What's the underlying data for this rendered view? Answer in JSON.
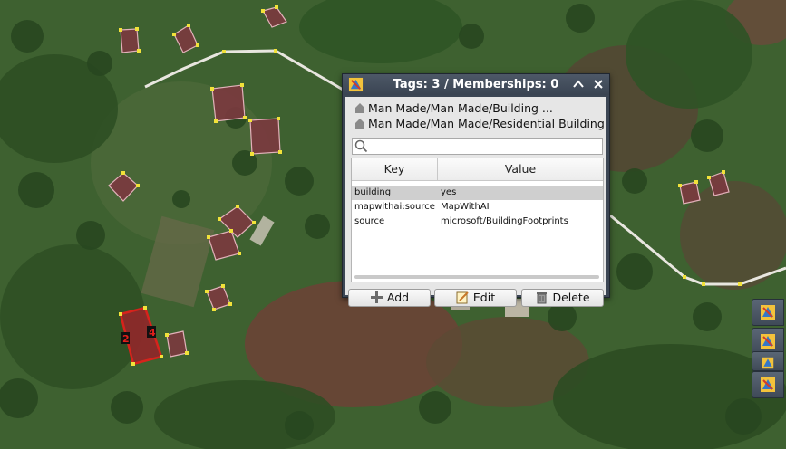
{
  "dialog": {
    "title": "Tags: 3 / Memberships: 0",
    "presets": [
      "Man Made/Man Made/Building ...",
      "Man Made/Man Made/Residential Building"
    ],
    "search_placeholder": "",
    "table": {
      "headers": {
        "key": "Key",
        "value": "Value"
      },
      "rows": [
        {
          "key": "building",
          "value": "yes"
        },
        {
          "key": "mapwithai:source",
          "value": "MapWithAI"
        },
        {
          "key": "source",
          "value": "microsoft/BuildingFootprints"
        }
      ]
    },
    "buttons": {
      "add": "Add",
      "edit": "Edit",
      "delete": "Delete"
    }
  },
  "map": {
    "selected_way_labels": [
      "2",
      "4"
    ]
  },
  "colors": {
    "selected": "#e0201b",
    "node": "#f2e23a",
    "building_fill": "#7a3a3f",
    "road": "#e8e6df",
    "dialog_bg": "#3c4654"
  }
}
